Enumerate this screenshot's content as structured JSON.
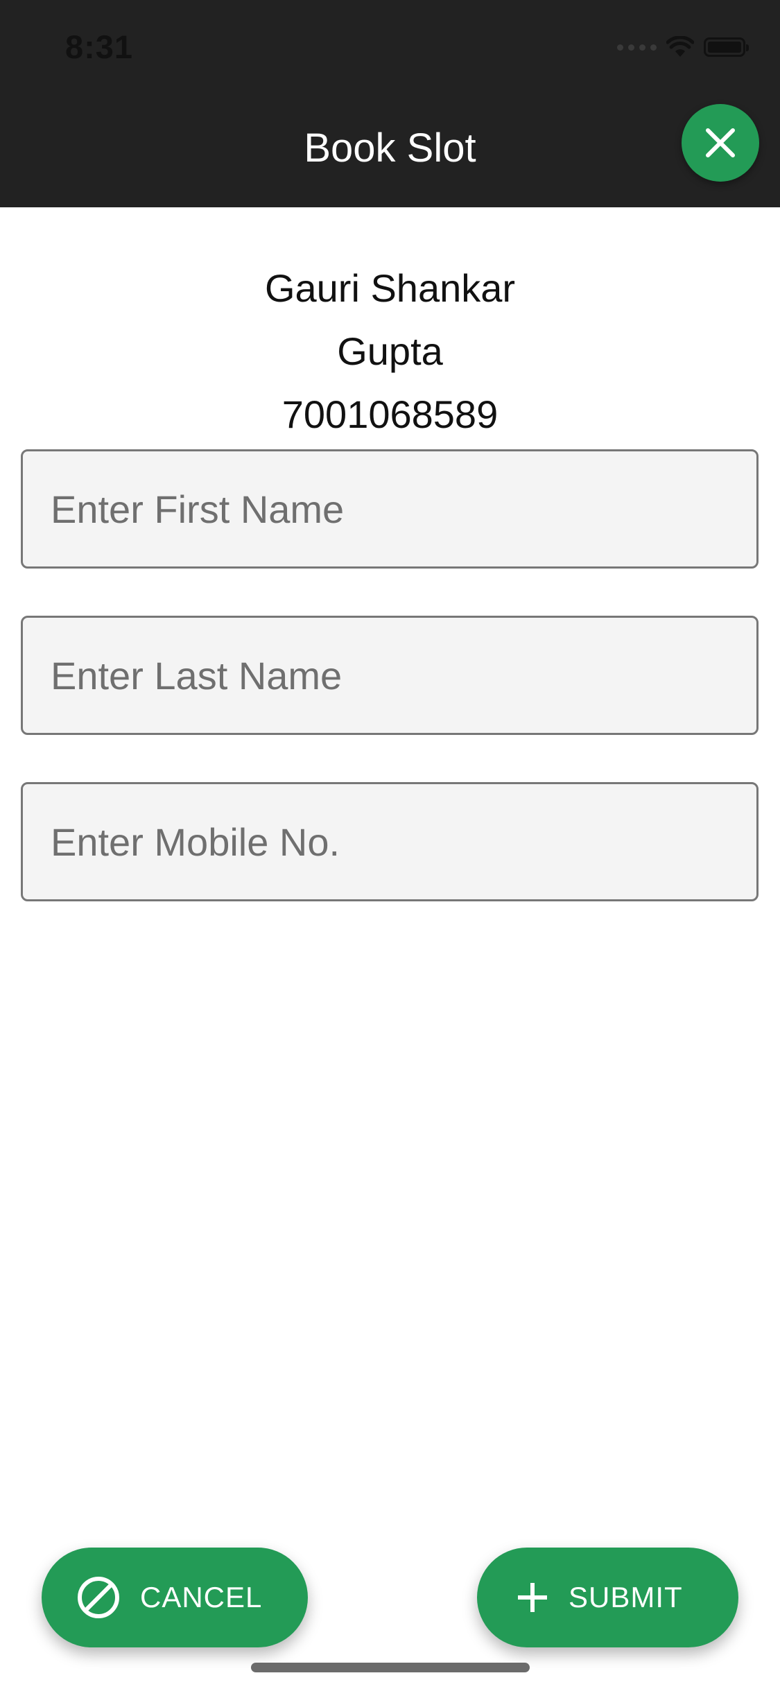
{
  "status_bar": {
    "time": "8:31"
  },
  "header": {
    "title": "Book Slot",
    "close_icon": "close-icon"
  },
  "info": {
    "first_name": "Gauri Shankar",
    "last_name": "Gupta",
    "mobile": "7001068589"
  },
  "form": {
    "first_name_placeholder": "Enter First Name",
    "last_name_placeholder": "Enter Last Name",
    "mobile_placeholder": "Enter Mobile No."
  },
  "actions": {
    "cancel_label": "CANCEL",
    "cancel_icon": "block-icon",
    "submit_label": "SUBMIT",
    "submit_icon": "plus-icon"
  },
  "colors": {
    "header_bg": "#222222",
    "accent": "#239b56",
    "field_bg": "#f4f4f4",
    "field_border": "#777777"
  }
}
